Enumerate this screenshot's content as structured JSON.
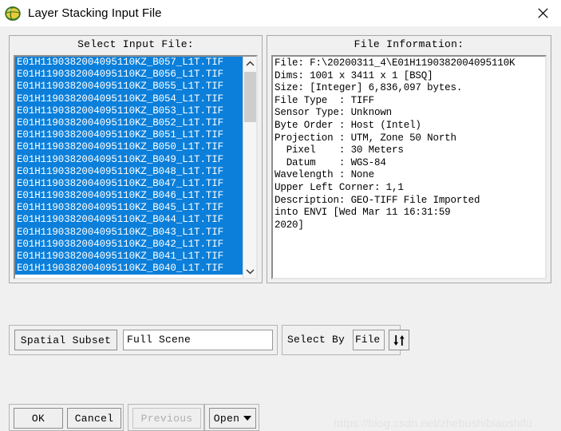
{
  "window": {
    "title": "Layer Stacking Input File",
    "icon": "envi-globe-icon",
    "close_label": "✕"
  },
  "left_panel": {
    "title": "Select Input File:",
    "files": [
      "E01H1190382004095110KZ_B057_L1T.TIF",
      "E01H1190382004095110KZ_B056_L1T.TIF",
      "E01H1190382004095110KZ_B055_L1T.TIF",
      "E01H1190382004095110KZ_B054_L1T.TIF",
      "E01H1190382004095110KZ_B053_L1T.TIF",
      "E01H1190382004095110KZ_B052_L1T.TIF",
      "E01H1190382004095110KZ_B051_L1T.TIF",
      "E01H1190382004095110KZ_B050_L1T.TIF",
      "E01H1190382004095110KZ_B049_L1T.TIF",
      "E01H1190382004095110KZ_B048_L1T.TIF",
      "E01H1190382004095110KZ_B047_L1T.TIF",
      "E01H1190382004095110KZ_B046_L1T.TIF",
      "E01H1190382004095110KZ_B045_L1T.TIF",
      "E01H1190382004095110KZ_B044_L1T.TIF",
      "E01H1190382004095110KZ_B043_L1T.TIF",
      "E01H1190382004095110KZ_B042_L1T.TIF",
      "E01H1190382004095110KZ_B041_L1T.TIF",
      "E01H1190382004095110KZ_B040_L1T.TIF"
    ],
    "selection_color": "#0b7fda",
    "scrollbar": {
      "up_icon": "chevron-up-icon",
      "down_icon": "chevron-down-icon"
    }
  },
  "right_panel": {
    "title": "File Information:",
    "lines": [
      "File: F:\\20200311_4\\E01H1190382004095110K",
      "Dims: 1001 x 3411 x 1 [BSQ]",
      "Size: [Integer] 6,836,097 bytes.",
      "File Type  : TIFF",
      "Sensor Type: Unknown",
      "Byte Order : Host (Intel)",
      "Projection : UTM, Zone 50 North",
      "  Pixel    : 30 Meters",
      "  Datum    : WGS-84",
      "Wavelength : None",
      "Upper Left Corner: 1,1",
      "Description: GEO-TIFF File Imported",
      "into ENVI [Wed Mar 11 16:31:59",
      "2020]"
    ]
  },
  "controls": {
    "spatial_subset_label": "Spatial Subset",
    "spatial_subset_value": "Full Scene",
    "select_by_label": "Select By",
    "select_by_value": "File",
    "swap_icon": "swap-arrows-icon"
  },
  "buttons": {
    "ok": "OK",
    "cancel": "Cancel",
    "previous": "Previous",
    "previous_disabled": true,
    "open": "Open",
    "open_caret_icon": "caret-down-icon"
  },
  "watermark": "https://blog.csdn.net/zhebushibiaoshifu"
}
